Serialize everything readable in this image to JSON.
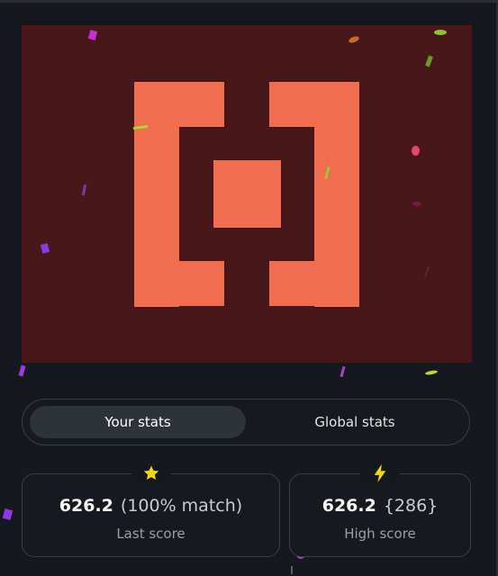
{
  "game": {
    "canvas_bg": "#4a1718",
    "shape_color": "#f06e4d"
  },
  "tabs": {
    "your_stats": "Your stats",
    "global_stats": "Global stats",
    "active": "your_stats"
  },
  "stats": {
    "last": {
      "value": "626.2",
      "detail": "(100% match)",
      "label": "Last score",
      "icon": "star-icon"
    },
    "high": {
      "value": "626.2",
      "detail": "{286}",
      "label": "High score",
      "icon": "lightning-icon"
    }
  }
}
